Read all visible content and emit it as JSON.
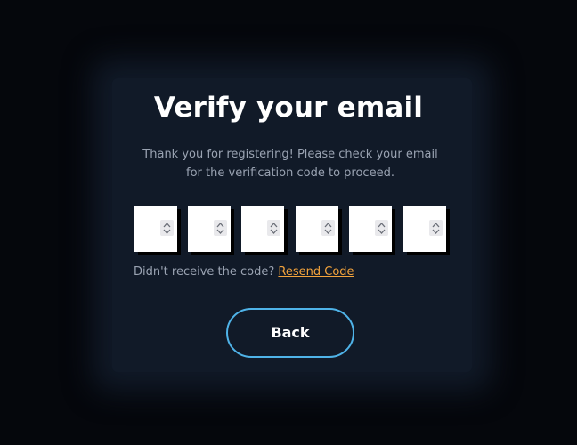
{
  "colors": {
    "page_background": "#05070c",
    "card_background": "#111a28",
    "title_text": "#ffffff",
    "body_text": "#9aa3b2",
    "link": "#f3a33c",
    "button_border": "#4fb3e8",
    "code_box_background": "#ffffff"
  },
  "verify": {
    "title": "Verify your email",
    "subtitle": "Thank you for registering! Please check your email for the verification code to proceed.",
    "code_inputs": [
      {
        "value": "",
        "spinner_icons": [
          "chevron-up-icon",
          "chevron-down-icon"
        ]
      },
      {
        "value": "",
        "spinner_icons": [
          "chevron-up-icon",
          "chevron-down-icon"
        ]
      },
      {
        "value": "",
        "spinner_icons": [
          "chevron-up-icon",
          "chevron-down-icon"
        ]
      },
      {
        "value": "",
        "spinner_icons": [
          "chevron-up-icon",
          "chevron-down-icon"
        ]
      },
      {
        "value": "",
        "spinner_icons": [
          "chevron-up-icon",
          "chevron-down-icon"
        ]
      },
      {
        "value": "",
        "spinner_icons": [
          "chevron-up-icon",
          "chevron-down-icon"
        ]
      }
    ],
    "resend_prompt": "Didn't receive the code?",
    "resend_link": "Resend Code",
    "back_label": "Back"
  }
}
